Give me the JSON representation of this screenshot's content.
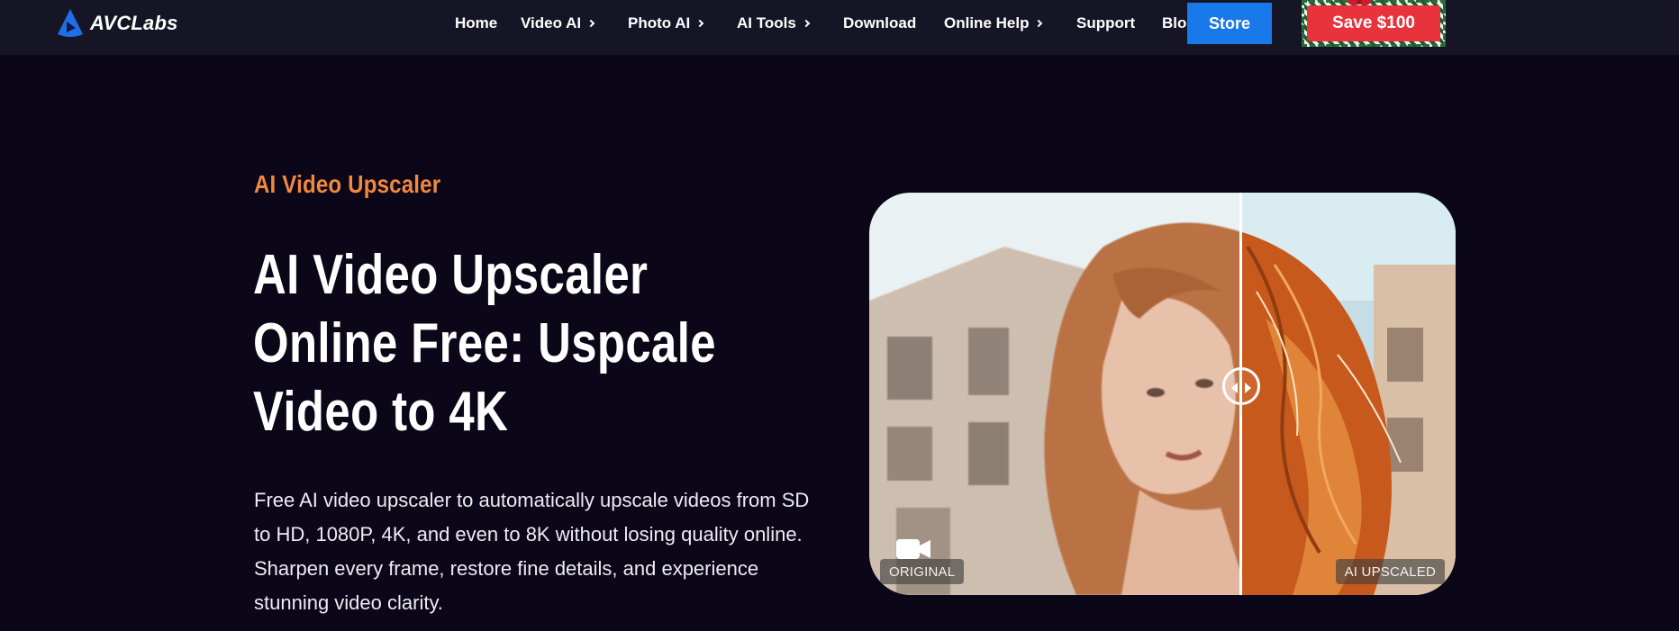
{
  "nav": {
    "logo_text": "AVCLabs",
    "items": [
      {
        "label": "Home",
        "has_submenu": false
      },
      {
        "label": "Video AI",
        "has_submenu": true
      },
      {
        "label": "Photo AI",
        "has_submenu": true
      },
      {
        "label": "AI Tools",
        "has_submenu": true
      },
      {
        "label": "Download",
        "has_submenu": false
      },
      {
        "label": "Online Help",
        "has_submenu": true
      },
      {
        "label": "Support",
        "has_submenu": false
      },
      {
        "label": "Blog",
        "has_submenu": true
      }
    ],
    "store_label": "Store",
    "promo_label": "Save $100"
  },
  "hero": {
    "eyebrow": "AI Video Upscaler",
    "headline_lines": [
      "AI Video Upscaler",
      "Online Free: Uspcale",
      "Video to 4K"
    ],
    "description": "Free AI video upscaler to automatically upscale videos from SD to HD, 1080P, 4K, and even to 8K without losing quality online. Sharpen every frame, restore fine details, and experience stunning video clarity."
  },
  "compare": {
    "label_original": "ORIGINAL",
    "label_upscaled": "AI UPSCALED"
  },
  "colors": {
    "page_bg": "#0b0618",
    "nav_bg": "#161526",
    "accent_orange": "#f0883e",
    "store_blue": "#1779ea",
    "promo_red": "#e8323c"
  },
  "icons": [
    "logo-play-icon",
    "chevron-right-icon",
    "slider-handle-icon",
    "video-camera-icon"
  ]
}
